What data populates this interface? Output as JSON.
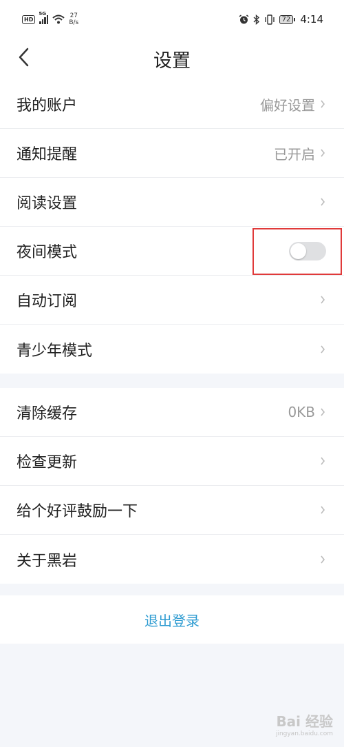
{
  "status_bar": {
    "hd": "HD",
    "network": "5G",
    "speed_value": "27",
    "speed_unit": "B/s",
    "battery": "72",
    "time": "4:14",
    "icons": [
      "alarm-icon",
      "bluetooth-icon",
      "vibrate-icon"
    ]
  },
  "header": {
    "title": "设置",
    "back_icon": "chevron-left-icon"
  },
  "groups": [
    {
      "items": [
        {
          "label": "我的账户",
          "value": "偏好设置",
          "type": "link"
        },
        {
          "label": "通知提醒",
          "value": "已开启",
          "type": "link"
        },
        {
          "label": "阅读设置",
          "value": "",
          "type": "link"
        },
        {
          "label": "夜间模式",
          "type": "toggle",
          "enabled": false
        },
        {
          "label": "自动订阅",
          "value": "",
          "type": "link"
        },
        {
          "label": "青少年模式",
          "value": "",
          "type": "link"
        }
      ]
    },
    {
      "items": [
        {
          "label": "清除缓存",
          "value": "0KB",
          "type": "link"
        },
        {
          "label": "检查更新",
          "value": "",
          "type": "link"
        },
        {
          "label": "给个好评鼓励一下",
          "value": "",
          "type": "link"
        },
        {
          "label": "关于黑岩",
          "value": "",
          "type": "link"
        }
      ]
    }
  ],
  "logout": {
    "label": "退出登录"
  },
  "colors": {
    "accent": "#2d9bd1",
    "highlight": "#e03a3a",
    "background": "#f4f6fa",
    "toggle_off": "#dfe0e2"
  },
  "watermark": {
    "main": "Bai 经验",
    "sub": "jingyan.baidu.com"
  }
}
